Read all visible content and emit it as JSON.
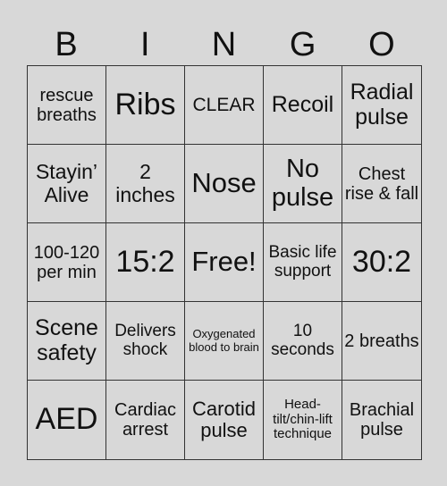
{
  "header": [
    "B",
    "I",
    "N",
    "G",
    "O"
  ],
  "cells": [
    "rescue breaths",
    "Ribs",
    "CLEAR",
    "Recoil",
    "Radial pulse",
    "Stayin’ Alive",
    "2 inches",
    "Nose",
    "No pulse",
    "Chest rise & fall",
    "100-120 per min",
    "15:2",
    "Free!",
    "Basic life support",
    "30:2",
    "Scene safety",
    "Delivers shock",
    "Oxygenated blood to brain",
    "10 seconds",
    "2 breaths",
    "AED",
    "Cardiac arrest",
    "Carotid pulse",
    "Head-tilt/chin-lift technique",
    "Brachial pulse"
  ],
  "colors": {
    "background": "#d8d8d8",
    "grid": "#333333",
    "text": "#111111"
  }
}
